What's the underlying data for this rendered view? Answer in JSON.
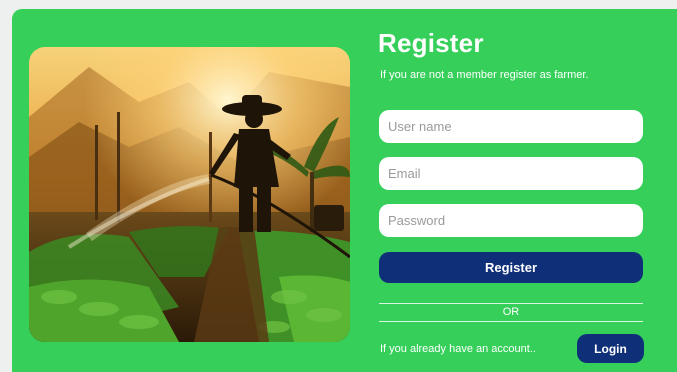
{
  "register": {
    "title": "Register",
    "subtitle": "If you are not a member register as farmer.",
    "username_placeholder": "User name",
    "email_placeholder": "Email",
    "password_placeholder": "Password",
    "register_button": "Register",
    "or_label": "OR",
    "already_text": "If you already have an account..",
    "login_button": "Login"
  },
  "colors": {
    "card_background": "#35cf5a",
    "button_background": "#0f2f78",
    "page_background": "#eef0f0"
  },
  "image": {
    "icon": "farmer-watering-crops-photo"
  }
}
